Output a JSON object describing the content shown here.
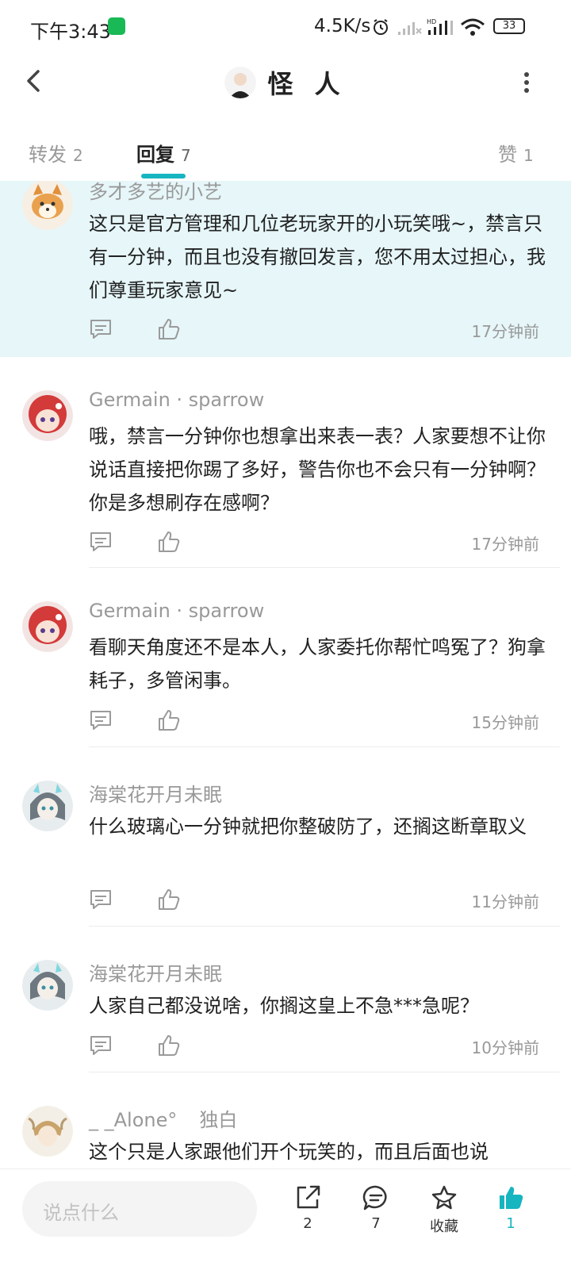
{
  "status_bar": {
    "time": "下午3:43",
    "speed": "4.5K/s",
    "battery": "33"
  },
  "header": {
    "title": "怪 人"
  },
  "tabs": [
    {
      "label": "转发",
      "count": "2"
    },
    {
      "label": "回复",
      "count": "7"
    },
    {
      "label": "赞",
      "count": "1"
    }
  ],
  "comments": [
    {
      "user": "多才多艺的小艺",
      "tag": "",
      "text": "这只是官方管理和几位老玩家开的小玩笑哦~，禁言只有一分钟，而且也没有撤回发言，您不用太过担心，我们尊重玩家意见~",
      "time": "17分钟前"
    },
    {
      "user": "Germain · sparrow",
      "tag": "",
      "text": "哦，禁言一分钟你也想拿出来表一表？人家要想不让你说话直接把你踢了多好，警告你也不会只有一分钟啊？你是多想刷存在感啊？",
      "time": "17分钟前"
    },
    {
      "user": "Germain · sparrow",
      "tag": "",
      "text": "看聊天角度还不是本人，人家委托你帮忙鸣冤了？狗拿耗子，多管闲事。",
      "time": "15分钟前"
    },
    {
      "user": "海棠花开月未眠",
      "tag": "",
      "text": "什么玻璃心一分钟就把你整破防了，还搁这断章取义",
      "time": "11分钟前"
    },
    {
      "user": "海棠花开月未眠",
      "tag": "",
      "text": "人家自己都没说啥，你搁这皇上不急***急呢？",
      "time": "10分钟前"
    },
    {
      "user": "_ _Alone°",
      "tag": "独白",
      "text": "这个只是人家跟他们开个玩笑的，而且后面也说",
      "time": ""
    }
  ],
  "bottom_bar": {
    "input_placeholder": "说点什么",
    "share_count": "2",
    "comment_count": "7",
    "favorite_label": "收藏",
    "like_count": "1"
  },
  "colors": {
    "accent": "#16b5c0",
    "highlight_bg": "#e6f6f9",
    "muted_text": "#999999"
  },
  "icons": [
    "back-arrow-icon",
    "more-vertical-icon",
    "reply-icon",
    "like-icon",
    "share-icon",
    "comment-icon",
    "star-icon",
    "thumbs-up-icon"
  ]
}
